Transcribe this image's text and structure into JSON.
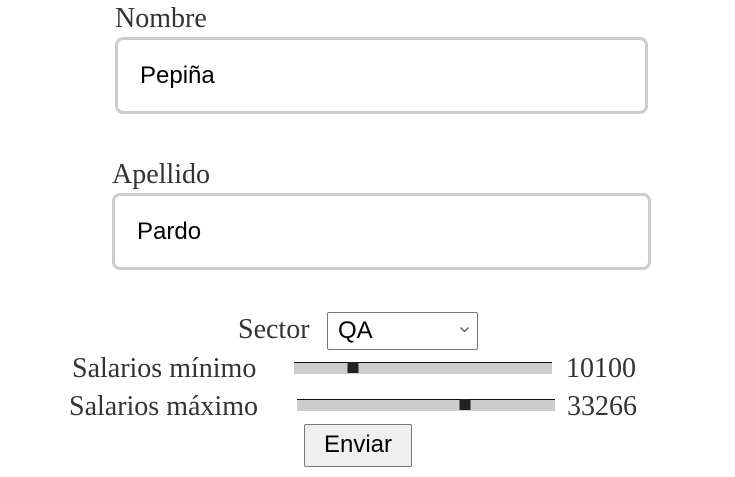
{
  "form": {
    "nombre": {
      "label": "Nombre",
      "value": "Pepiña"
    },
    "apellido": {
      "label": "Apellido",
      "value": "Pardo"
    },
    "sector": {
      "label": "Sector",
      "selected": "QA"
    },
    "salario_minimo": {
      "label": "Salarios mínimo",
      "value": "10100",
      "fraction": 0.23
    },
    "salario_maximo": {
      "label": "Salarios máximo",
      "value": "33266",
      "fraction": 0.65
    },
    "submit_label": "Enviar"
  }
}
